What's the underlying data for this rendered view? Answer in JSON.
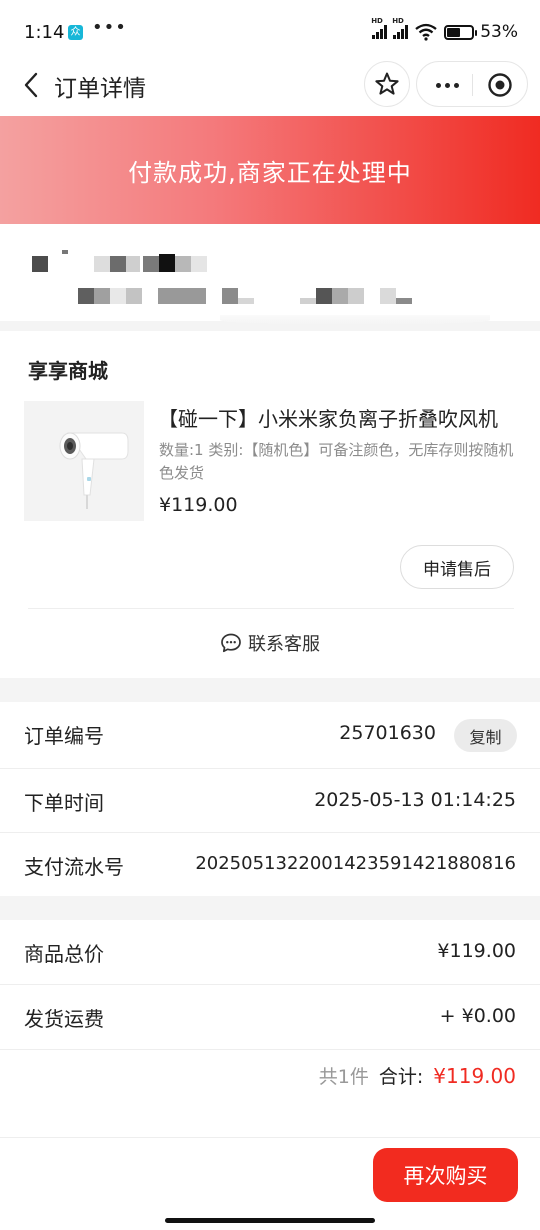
{
  "status_bar": {
    "time": "1:14",
    "app_icon_text": "众",
    "dots": "•••",
    "signal_1_label": "HD",
    "signal_2_label": "HD",
    "battery_percent": "53%",
    "battery_level": 0.53
  },
  "nav": {
    "title": "订单详情"
  },
  "banner": {
    "text": "付款成功,商家正在处理中"
  },
  "order": {
    "shop_name": "享享商城",
    "product": {
      "title": "【碰一下】小米米家负离子折叠吹风机",
      "spec": "数量:1 类别:【随机色】可备注颜色，无库存则按随机色发货",
      "price": "¥119.00"
    },
    "aftersale_label": "申请售后",
    "contact_label": "联系客服"
  },
  "details": {
    "order_number_label": "订单编号",
    "order_number": "25701630",
    "copy_label": "复制",
    "order_time_label": "下单时间",
    "order_time": "2025-05-13 01:14:25",
    "serial_label": "支付流水号",
    "serial_value": "2025051322001423591421880816"
  },
  "summary": {
    "goods_total_label": "商品总价",
    "goods_total": "¥119.00",
    "shipping_label": "发货运费",
    "shipping": "+ ¥0.00",
    "count_text": "共1件",
    "sum_label": "合计:",
    "sum_amount": "¥119.00"
  },
  "actions": {
    "buy_again_label": "再次购买"
  },
  "colors": {
    "accent": "#f02b22",
    "banner_start": "#f4a1a0",
    "banner_end": "#f02b22"
  },
  "icons": {
    "back": "back-arrow-icon",
    "star": "star-icon",
    "more": "more-dots-icon",
    "target": "target-icon",
    "chat": "chat-bubble-icon"
  }
}
